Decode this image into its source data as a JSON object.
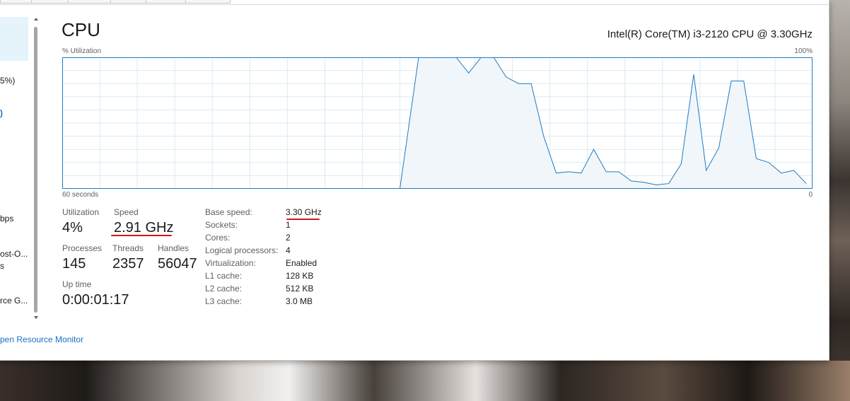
{
  "sidebar": {
    "fragments": [
      "5%)",
      "bps",
      "ost-O...",
      "s",
      "rce G..."
    ],
    "open_resource_monitor": "pen Resource Monitor"
  },
  "header": {
    "title": "CPU",
    "cpu_model": "Intel(R) Core(TM) i3-2120 CPU @ 3.30GHz"
  },
  "graph": {
    "label_top_left": "% Utilization",
    "label_top_right": "100%",
    "label_bottom_left": "60 seconds",
    "label_bottom_right": "0",
    "line_color": "#1f7cc1",
    "fill_color": "#f1f6fa",
    "grid_color": "#d9eaf4",
    "chart_data": {
      "type": "area",
      "x": [
        0,
        2,
        4,
        6,
        8,
        10,
        12,
        14,
        16,
        18,
        20,
        22,
        24,
        26,
        28,
        30,
        32,
        34,
        36,
        38,
        40,
        42,
        44,
        46,
        48,
        50,
        52,
        54,
        56,
        58,
        60
      ],
      "values": [
        0,
        0,
        0,
        0,
        0,
        0,
        0,
        0,
        0,
        0,
        0,
        0,
        0,
        0,
        0,
        0,
        0,
        0,
        0,
        0,
        0,
        0,
        0,
        0,
        0,
        0,
        0,
        0,
        0,
        0,
        0
      ],
      "series_points": [
        [
          60,
          0
        ],
        [
          33,
          0
        ],
        [
          31.5,
          100
        ],
        [
          28.5,
          100
        ],
        [
          27.5,
          88
        ],
        [
          26.5,
          100
        ],
        [
          25.5,
          100
        ],
        [
          24.5,
          85
        ],
        [
          23.5,
          80
        ],
        [
          22.5,
          80
        ],
        [
          21.5,
          40
        ],
        [
          20.5,
          12
        ],
        [
          19.5,
          13
        ],
        [
          18.5,
          12
        ],
        [
          17.5,
          30
        ],
        [
          16.5,
          13
        ],
        [
          15.5,
          13
        ],
        [
          14.5,
          6
        ],
        [
          13.5,
          5
        ],
        [
          12.5,
          3
        ],
        [
          11.5,
          4
        ],
        [
          10.5,
          19
        ],
        [
          9.5,
          87
        ],
        [
          8.5,
          14
        ],
        [
          7.5,
          31
        ],
        [
          6.5,
          82
        ],
        [
          5.5,
          82
        ],
        [
          4.5,
          23
        ],
        [
          3.5,
          20
        ],
        [
          2.5,
          12
        ],
        [
          1.5,
          14
        ],
        [
          0.5,
          4
        ],
        [
          0,
          0
        ]
      ],
      "xlim": [
        60,
        0
      ],
      "ylim": [
        0,
        100
      ]
    }
  },
  "stats": {
    "utilization_label": "Utilization",
    "utilization_value": "4%",
    "speed_label": "Speed",
    "speed_value": "2.91 GHz",
    "processes_label": "Processes",
    "processes_value": "145",
    "threads_label": "Threads",
    "threads_value": "2357",
    "handles_label": "Handles",
    "handles_value": "56047",
    "uptime_label": "Up time",
    "uptime_value": "0:00:01:17"
  },
  "specs": [
    {
      "label": "Base speed:",
      "value": "3.30 GHz"
    },
    {
      "label": "Sockets:",
      "value": "1"
    },
    {
      "label": "Cores:",
      "value": "2"
    },
    {
      "label": "Logical processors:",
      "value": "4"
    },
    {
      "label": "Virtualization:",
      "value": "Enabled"
    },
    {
      "label": "L1 cache:",
      "value": "128 KB"
    },
    {
      "label": "L2 cache:",
      "value": "512 KB"
    },
    {
      "label": "L3 cache:",
      "value": "3.0 MB"
    }
  ],
  "annotation_color": "#d4161c"
}
